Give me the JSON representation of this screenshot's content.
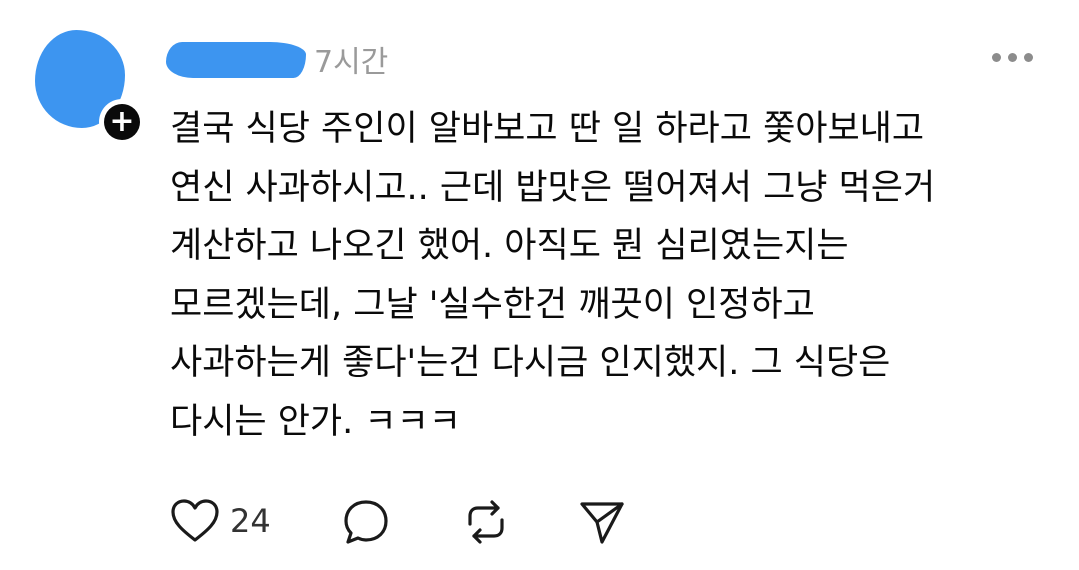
{
  "post": {
    "username": "",
    "timestamp": "7시간",
    "body_lines": [
      "결국 식당 주인이 알바보고 딴 일 하라고 쫓아보내고",
      "연신 사과하시고.. 근데 밥맛은 떨어져서 그냥 먹은거",
      "계산하고 나오긴 했어. 아직도 뭔 심리였는지는",
      "모르겠는데, 그날 '실수한건 깨끗이 인정하고",
      "사과하는게 좋다'는건 다시금 인지했지. 그 식당은",
      "다시는 안가. ㅋㅋㅋ"
    ],
    "like_count": "24",
    "follow_badge": "+"
  },
  "icons": {
    "like": "heart-outline-icon",
    "comment": "speech-bubble-icon",
    "repost": "repost-arrows-icon",
    "share": "paper-plane-icon",
    "more": "more-horizontal-icon"
  },
  "colors": {
    "text": "#0a0a0a",
    "muted": "#9a9a9a",
    "redaction": "#3d95f0",
    "badge": "#0a0a0a"
  }
}
